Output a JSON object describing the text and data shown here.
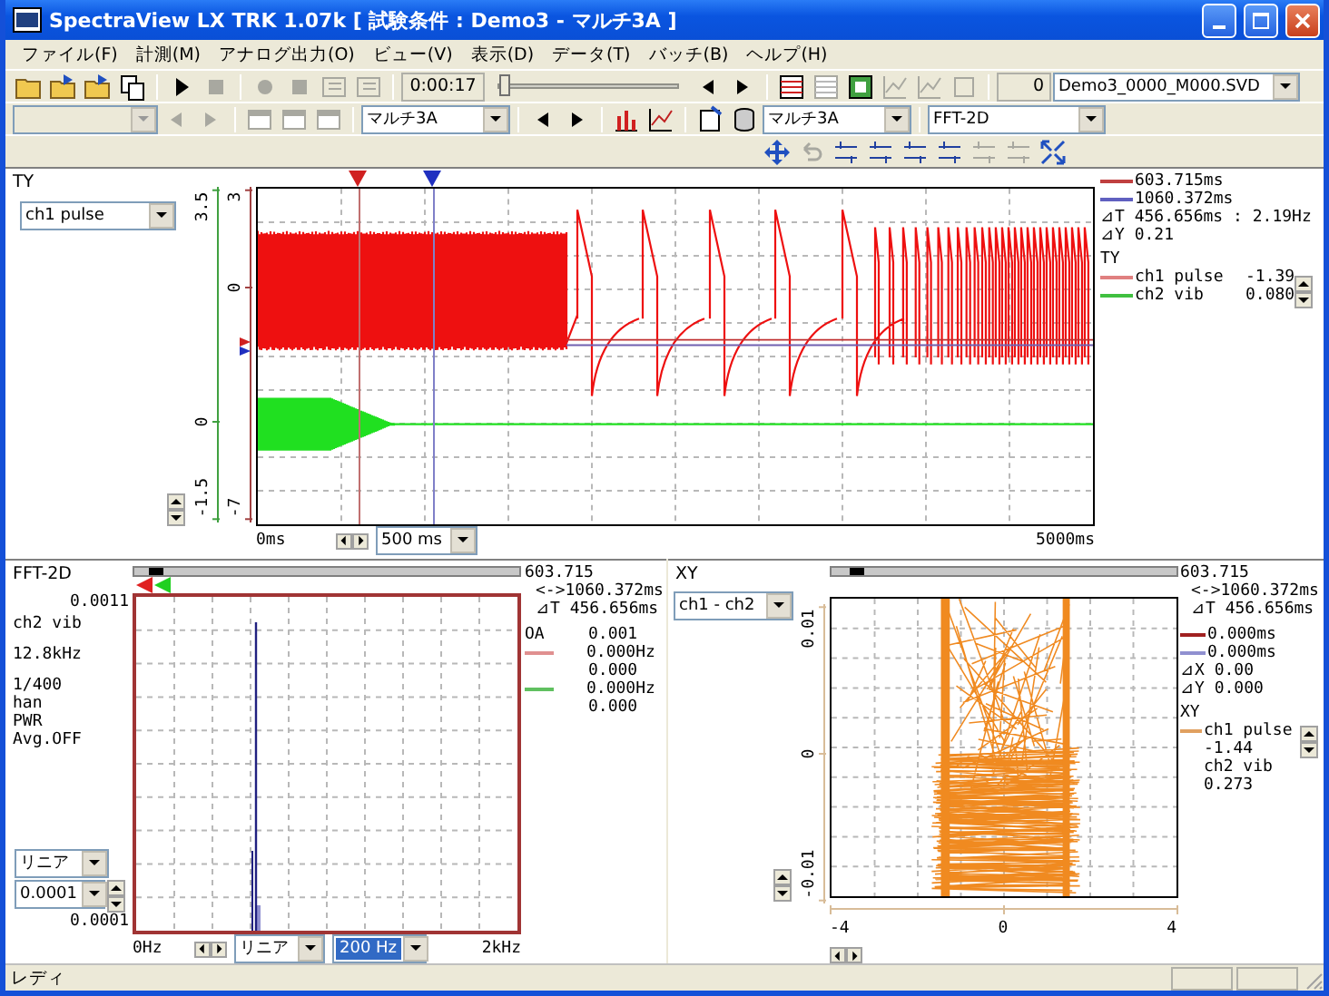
{
  "window": {
    "title": "SpectraView LX TRK 1.07k [ 試験条件 : Demo3 - マルチ3A ]"
  },
  "menu": [
    "ファイル(F)",
    "計測(M)",
    "アナログ出力(O)",
    "ビュー(V)",
    "表示(D)",
    "データ(T)",
    "バッチ(B)",
    "ヘルプ(H)"
  ],
  "toolbar_1": {
    "file_buttons": [
      {
        "disabled": false
      },
      {
        "disabled": false
      },
      {
        "disabled": false
      },
      {
        "disabled": false
      }
    ],
    "transport_buttons": [
      {
        "disabled": false
      },
      {
        "disabled": true
      }
    ],
    "record_buttons": [
      {
        "disabled": true
      },
      {
        "disabled": true
      },
      {
        "disabled": true
      },
      {
        "disabled": true
      }
    ],
    "elapsed": "0:00:17",
    "position": {
      "level": 0.03
    },
    "seek_buttons": [
      {
        "disabled": false
      },
      {
        "disabled": false
      }
    ],
    "view_buttons": [
      {
        "disabled": false
      },
      {
        "disabled": true
      },
      {
        "disabled": false
      },
      {
        "disabled": true
      },
      {
        "disabled": true
      },
      {
        "disabled": true
      }
    ],
    "counter": "0",
    "file": "Demo3_0000_M000.SVD"
  },
  "toolbar_2": {
    "blank_select": {
      "disabled": true
    },
    "nav_buttons": [
      {
        "disabled": true
      },
      {
        "disabled": true
      }
    ],
    "window_buttons": [
      {
        "disabled": true
      },
      {
        "disabled": true
      },
      {
        "disabled": true
      }
    ],
    "layout": "マルチ3A",
    "layout_nav": [
      {
        "disabled": false
      },
      {
        "disabled": false
      }
    ],
    "chart_buttons": [
      {
        "disabled": false
      },
      {
        "disabled": false
      }
    ],
    "tool_buttons": [
      {
        "disabled": false
      },
      {
        "disabled": false
      }
    ],
    "channel_set": "マルチ3A",
    "graph_type": "FFT-2D"
  },
  "toolbar_3": {
    "buttons": [
      {
        "disabled": false
      },
      {
        "disabled": true
      },
      {
        "disabled": false
      },
      {
        "disabled": false
      },
      {
        "disabled": false
      },
      {
        "disabled": false
      },
      {
        "disabled": true
      },
      {
        "disabled": true
      },
      {
        "disabled": false
      }
    ]
  },
  "ty": {
    "title": "TY",
    "channel": "ch1 pulse",
    "left_axis": [
      "3.5",
      "0",
      "-1.5"
    ],
    "right_axis": [
      "3",
      "0",
      "-7"
    ],
    "x_start": "0ms",
    "x_end": "5000ms",
    "time_div": "500 ms",
    "cursors": [
      {
        "time": "603.715ms",
        "color": "#c04040"
      },
      {
        "time": "1060.372ms",
        "color": "#6060c0"
      }
    ],
    "delta_t": "⊿T 456.656ms : 2.19Hz",
    "delta_y": "⊿Y 0.21",
    "group": "TY",
    "channels": [
      {
        "name": "ch1 pulse",
        "value": "-1.39",
        "color": "#e08080"
      },
      {
        "name": "ch2 vib",
        "value": "0.080",
        "color": "#40c040"
      }
    ]
  },
  "fft": {
    "title": "FFT-2D",
    "scroll": {
      "level": 0.04
    },
    "readouts": [
      "603.715",
      "<->1060.372ms",
      "⊿T 456.656ms"
    ],
    "info_groups": [
      [
        "ch2 vib"
      ],
      [
        "12.8kHz"
      ],
      [
        "1/400",
        "han",
        "PWR",
        "Avg.OFF"
      ]
    ],
    "y_max": "0.0011",
    "y_min": "0.0001",
    "scale": "リニア",
    "y_range": "0.0001",
    "x_start": "0Hz",
    "x_end": "2kHz",
    "x_scale": "リニア",
    "x_range": {
      "value": "200 Hz",
      "focused": true
    },
    "overall": {
      "label": "OA",
      "value": "0.001"
    },
    "cursors": [
      {
        "color": "#e09090",
        "freq": "0.000Hz",
        "value": "0.000"
      },
      {
        "color": "#60c060",
        "freq": "0.000Hz",
        "value": "0.000"
      }
    ]
  },
  "xy": {
    "title": "XY",
    "pair": "ch1 - ch2",
    "scroll": {
      "level": 0.05
    },
    "y_axis": [
      "0.01",
      "0",
      "-0.01"
    ],
    "x_axis": [
      "-4",
      "0",
      "4"
    ],
    "readouts": [
      "603.715",
      "<->1060.372ms",
      "⊿T 456.656ms"
    ],
    "cursors": [
      {
        "time": "0.000ms",
        "color": "#a02020"
      },
      {
        "time": "0.000ms",
        "color": "#9090d0"
      }
    ],
    "delta_x": "⊿X 0.00",
    "delta_y": "⊿Y 0.000",
    "group": "XY",
    "trace_lines": [
      "ch1 pulse",
      "-1.44",
      "ch2 vib",
      "0.273"
    ]
  },
  "status": {
    "text": "レディ"
  }
}
